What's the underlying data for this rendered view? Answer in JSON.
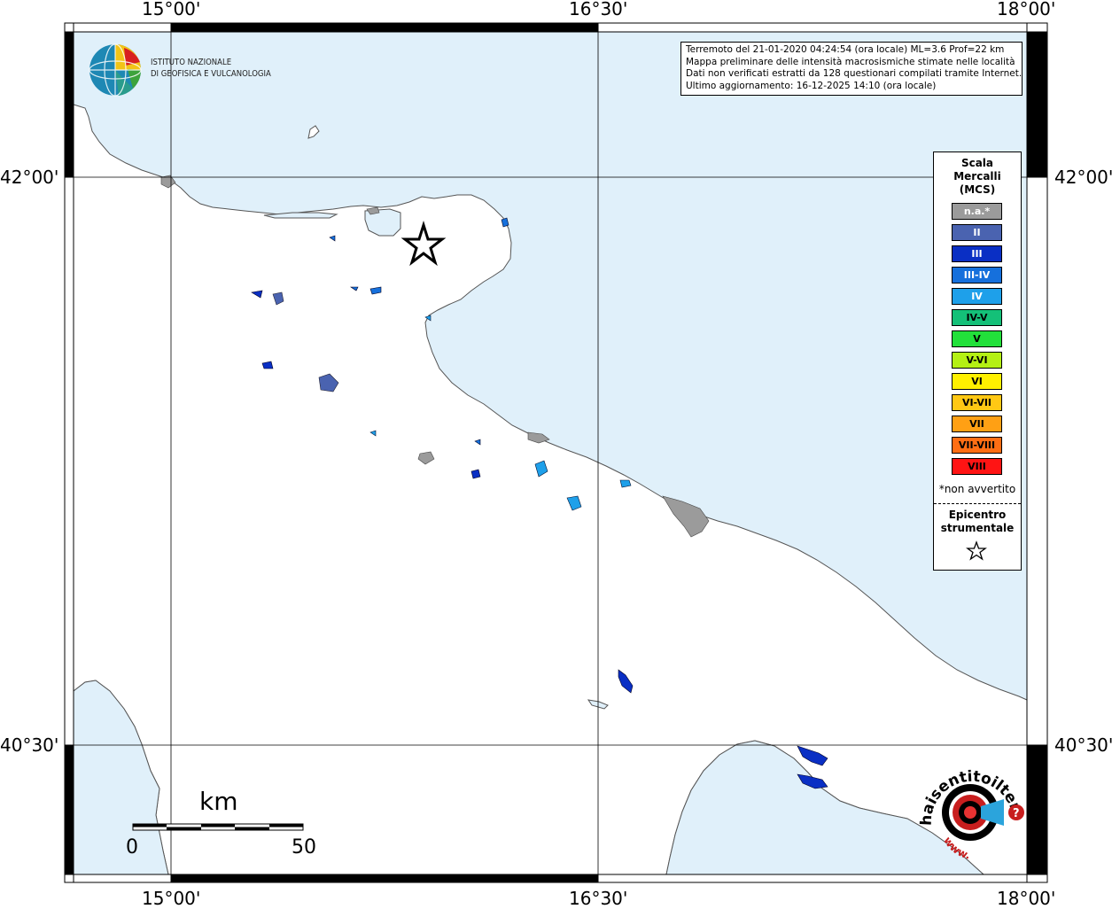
{
  "map": {
    "lon_ticks_top": [
      "15°00'",
      "16°30'",
      "18°00'"
    ],
    "lon_ticks_bottom": [
      "15°00'",
      "16°30'",
      "18°00'"
    ],
    "lat_ticks_left": [
      "42°00'",
      "40°30'"
    ],
    "lat_ticks_right": [
      "42°00'",
      "40°30'"
    ],
    "sea_color": "#e0f0fa",
    "land_color": "#ffffff"
  },
  "institute": {
    "line1": "ISTITUTO NAZIONALE",
    "line2": "DI GEOFISICA E VULCANOLOGIA"
  },
  "info": {
    "line1": "Terremoto del 21-01-2020 04:24:54 (ora locale) ML=3.6 Prof=22 km",
    "line2": "Mappa preliminare delle intensità macrosismiche stimate nelle località",
    "line3": "Dati non verificati estratti da 128 questionari compilati tramite Internet.",
    "line4": "Ultimo aggiornamento: 16-12-2025 14:10 (ora locale)"
  },
  "legend": {
    "title_line1": "Scala",
    "title_line2": "Mercalli",
    "title_line3": "(MCS)",
    "items": [
      {
        "label": "n.a.*",
        "color": "#9b9b9b",
        "text": "#ffffff"
      },
      {
        "label": "II",
        "color": "#4a63b0",
        "text": "#ffffff"
      },
      {
        "label": "III",
        "color": "#0a2fc4",
        "text": "#ffffff"
      },
      {
        "label": "III-IV",
        "color": "#1670dc",
        "text": "#ffffff"
      },
      {
        "label": "IV",
        "color": "#1ea0ea",
        "text": "#ffffff"
      },
      {
        "label": "IV-V",
        "color": "#14c078",
        "text": "#000000"
      },
      {
        "label": "V",
        "color": "#22e03a",
        "text": "#000000"
      },
      {
        "label": "V-VI",
        "color": "#b4f014",
        "text": "#000000"
      },
      {
        "label": "VI",
        "color": "#fff000",
        "text": "#000000"
      },
      {
        "label": "VI-VII",
        "color": "#ffc814",
        "text": "#000000"
      },
      {
        "label": "VII",
        "color": "#ffa014",
        "text": "#000000"
      },
      {
        "label": "VII-VIII",
        "color": "#ff6e14",
        "text": "#000000"
      },
      {
        "label": "VIII",
        "color": "#ff1414",
        "text": "#000000"
      }
    ],
    "note": "*non avvertito",
    "epicenter_line1": "Epicentro",
    "epicenter_line2": "strumentale"
  },
  "scale": {
    "unit": "km",
    "min": "0",
    "max": "50"
  },
  "hsit": {
    "text": "haisentitoilterremoto.it",
    "prefix": "www."
  }
}
